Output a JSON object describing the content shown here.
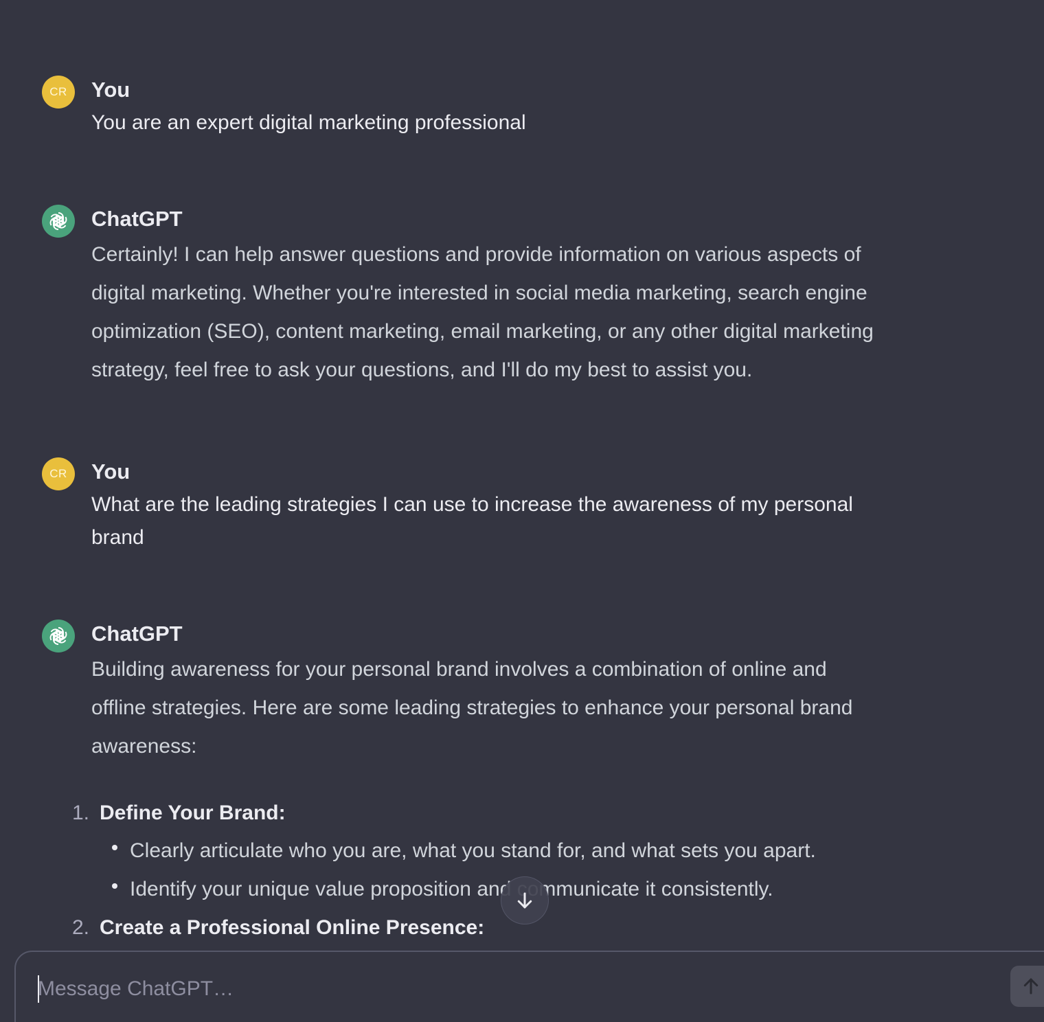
{
  "colors": {
    "background": "#343541",
    "user_avatar": "#e9bf3c",
    "assistant_avatar": "#4aa37c",
    "text_primary": "#ececf1",
    "text_secondary": "#d1d5db"
  },
  "messages": [
    {
      "role": "user",
      "avatar_initials": "CR",
      "author": "You",
      "text": "You are an expert digital marketing professional"
    },
    {
      "role": "assistant",
      "avatar_icon": "openai-logo-icon",
      "author": "ChatGPT",
      "lines": [
        "Certainly! I can help answer questions and provide information on various aspects of",
        "digital marketing. Whether you're interested in social media marketing, search engine",
        "optimization (SEO), content marketing, email marketing, or any other digital marketing",
        "strategy, feel free to ask your questions, and I'll do my best to assist you."
      ]
    },
    {
      "role": "user",
      "avatar_initials": "CR",
      "author": "You",
      "lines": [
        "What are the leading strategies I can use to increase the awareness of my personal",
        "brand"
      ]
    },
    {
      "role": "assistant",
      "avatar_icon": "openai-logo-icon",
      "author": "ChatGPT",
      "lines": [
        "Building awareness for your personal brand involves a combination of online and",
        "offline strategies. Here are some leading strategies to enhance your personal brand",
        "awareness:"
      ],
      "list": [
        {
          "number": "1.",
          "title": "Define Your Brand:",
          "bullets": [
            "Clearly articulate who you are, what you stand for, and what sets you apart.",
            "Identify your unique value proposition and communicate it consistently."
          ]
        },
        {
          "number": "2.",
          "title": "Create a Professional Online Presence:",
          "bullets": []
        }
      ]
    }
  ],
  "scroll_button": {
    "icon": "arrow-down-icon"
  },
  "composer": {
    "placeholder": "Message ChatGPT…",
    "value": "",
    "send_icon": "arrow-up-icon"
  }
}
